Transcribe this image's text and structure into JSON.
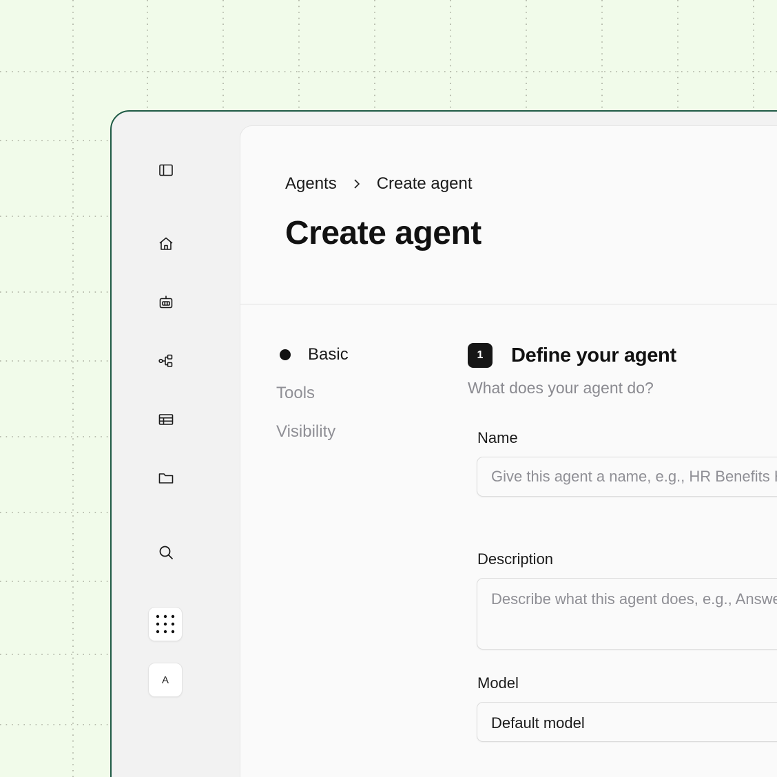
{
  "app": {
    "accent_color": "#1e5a45",
    "background_color": "#f1fbea"
  },
  "sidebar": {
    "icons": [
      {
        "name": "sidebar-toggle-icon"
      },
      {
        "name": "home-icon"
      },
      {
        "name": "robot-icon"
      },
      {
        "name": "workflow-icon"
      },
      {
        "name": "table-icon"
      },
      {
        "name": "folder-icon"
      },
      {
        "name": "search-icon"
      },
      {
        "name": "apps-grid-icon"
      }
    ],
    "avatar_initial": "A"
  },
  "breadcrumb": {
    "parent": "Agents",
    "current": "Create agent"
  },
  "page_title": "Create agent",
  "steps": [
    {
      "label": "Basic",
      "active": true
    },
    {
      "label": "Tools",
      "active": false
    },
    {
      "label": "Visibility",
      "active": false
    }
  ],
  "section": {
    "number": "1",
    "title": "Define your agent",
    "subtitle": "What does your agent do?"
  },
  "form": {
    "name_label": "Name",
    "name_placeholder": "Give this agent a name, e.g., HR Benefits Helper",
    "name_value": "",
    "description_label": "Description",
    "description_placeholder": "Describe what this agent does, e.g., Answers questions about HR benefits",
    "description_value": "",
    "model_label": "Model",
    "model_value": "Default model"
  }
}
